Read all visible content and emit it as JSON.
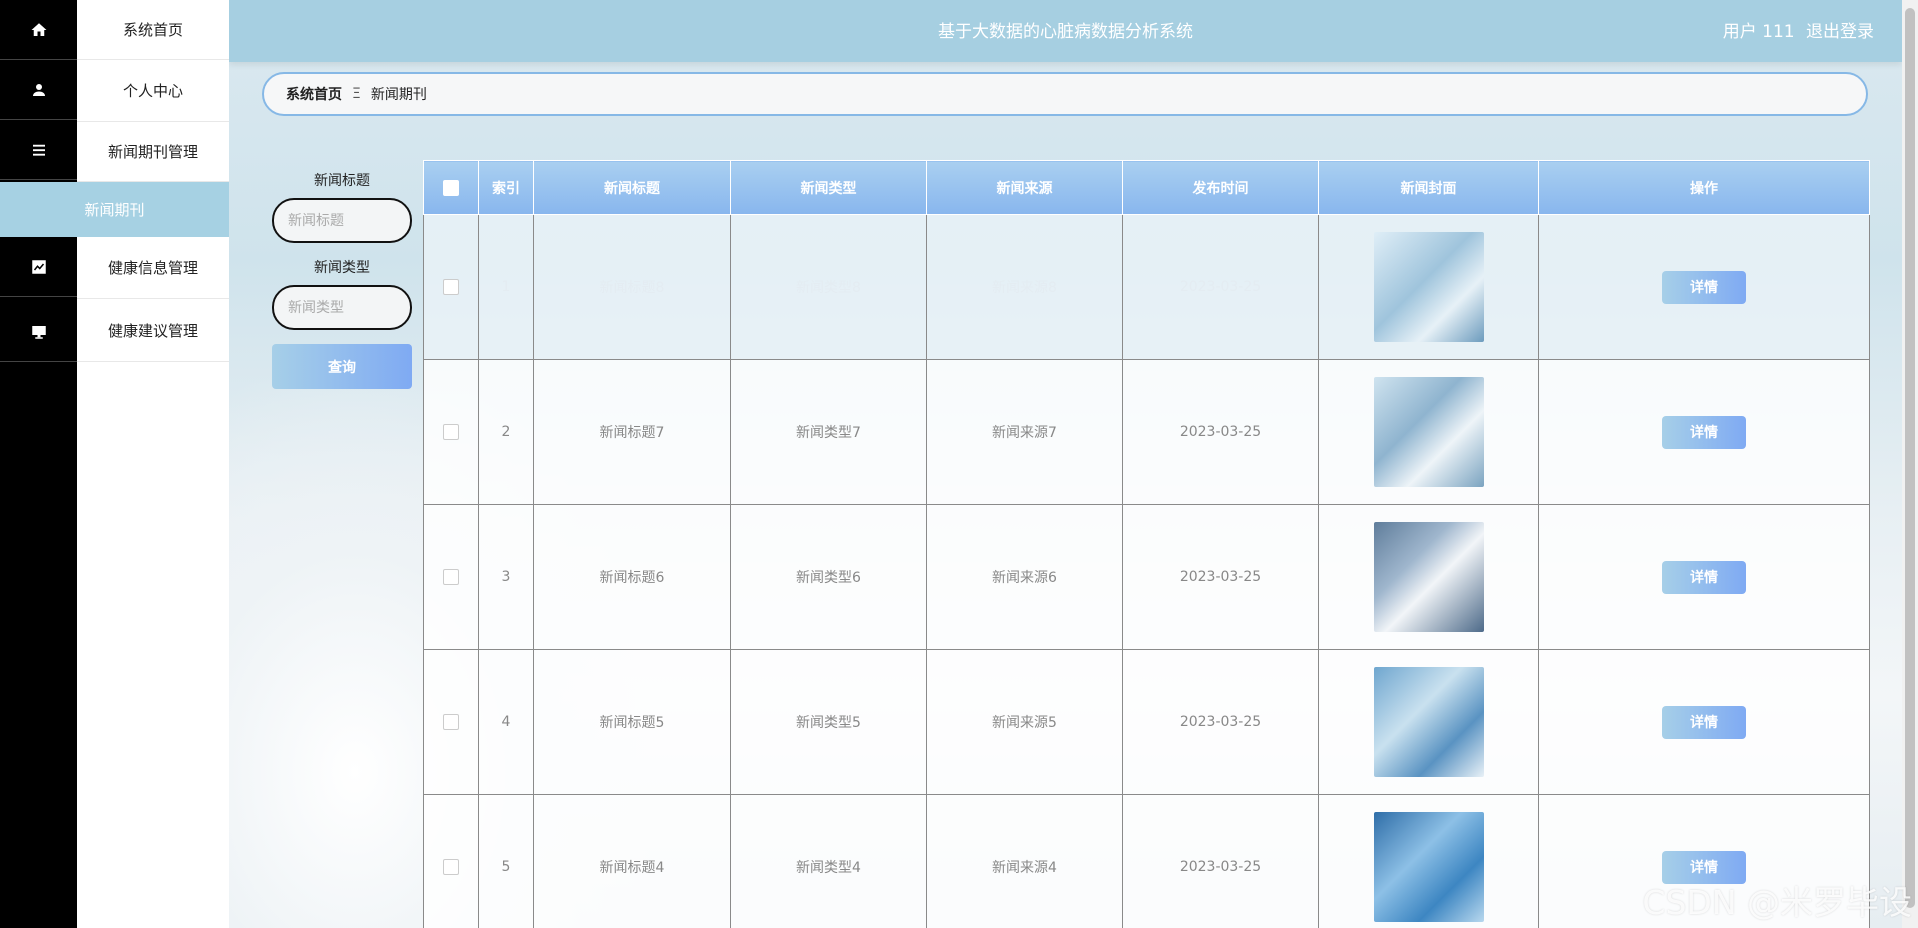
{
  "sidebar": {
    "items": [
      {
        "label": "系统首页",
        "icon": "home-icon"
      },
      {
        "label": "个人中心",
        "icon": "user-icon"
      },
      {
        "label": "新闻期刊管理",
        "icon": "list-icon"
      },
      {
        "label": "健康信息管理",
        "icon": "chart-icon"
      },
      {
        "label": "健康建议管理",
        "icon": "monitor-icon"
      }
    ],
    "submenu_active": "新闻期刊"
  },
  "header": {
    "title": "基于大数据的心脏病数据分析系统",
    "user_label": "用户 111",
    "logout_label": "退出登录"
  },
  "breadcrumb": {
    "home": "系统首页",
    "separator": "Ξ",
    "current": "新闻期刊"
  },
  "search": {
    "title_label": "新闻标题",
    "title_placeholder": "新闻标题",
    "type_label": "新闻类型",
    "type_placeholder": "新闻类型",
    "query_button": "查询"
  },
  "table": {
    "columns": [
      "索引",
      "新闻标题",
      "新闻类型",
      "新闻来源",
      "发布时间",
      "新闻封面",
      "操作"
    ],
    "rows": [
      {
        "index": "1",
        "title": "新闻标题8",
        "type": "新闻类型8",
        "source": "新闻来源8",
        "date": "2023-03-25",
        "cover_icon": "vaccine-image",
        "action": "详情"
      },
      {
        "index": "2",
        "title": "新闻标题7",
        "type": "新闻类型7",
        "source": "新闻来源7",
        "date": "2023-03-25",
        "cover_icon": "doctors-image",
        "action": "详情"
      },
      {
        "index": "3",
        "title": "新闻标题6",
        "type": "新闻类型6",
        "source": "新闻来源6",
        "date": "2023-03-25",
        "cover_icon": "doctor-image",
        "action": "详情"
      },
      {
        "index": "4",
        "title": "新闻标题5",
        "type": "新闻类型5",
        "source": "新闻来源5",
        "date": "2023-03-25",
        "cover_icon": "surgery-image",
        "action": "详情"
      },
      {
        "index": "5",
        "title": "新闻标题4",
        "type": "新闻类型4",
        "source": "新闻来源4",
        "date": "2023-03-25",
        "cover_icon": "tablet-doctor-image",
        "action": "详情"
      }
    ]
  },
  "watermark": "CSDN @米罗毕设",
  "colors": {
    "accent": "#a6d1e3",
    "header": "#a6cfe1",
    "button_gradient_start": "#a6cfe8",
    "button_gradient_end": "#7faaf3"
  }
}
